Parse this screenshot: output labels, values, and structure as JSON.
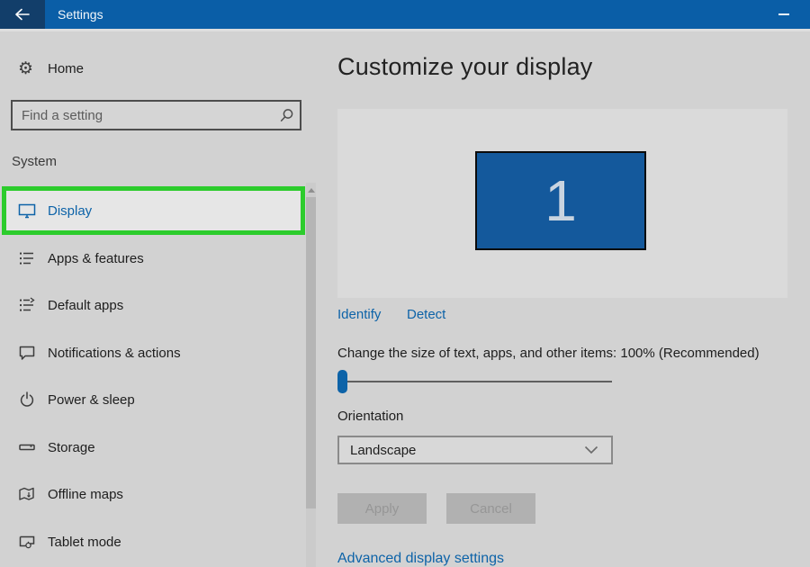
{
  "titlebar": {
    "title": "Settings"
  },
  "icons": {
    "gear_glyph": "⚙"
  },
  "sidebar": {
    "home_label": "Home",
    "search_placeholder": "Find a setting",
    "section_header": "System",
    "items": [
      {
        "label": "Display",
        "icon": "monitor-icon",
        "selected": true
      },
      {
        "label": "Apps & features",
        "icon": "apps-list-icon",
        "selected": false
      },
      {
        "label": "Default apps",
        "icon": "default-apps-icon",
        "selected": false
      },
      {
        "label": "Notifications & actions",
        "icon": "notifications-icon",
        "selected": false
      },
      {
        "label": "Power & sleep",
        "icon": "power-icon",
        "selected": false
      },
      {
        "label": "Storage",
        "icon": "storage-icon",
        "selected": false
      },
      {
        "label": "Offline maps",
        "icon": "offline-maps-icon",
        "selected": false
      },
      {
        "label": "Tablet mode",
        "icon": "tablet-icon",
        "selected": false
      }
    ]
  },
  "main": {
    "heading": "Customize your display",
    "monitor_number": "1",
    "identify_link": "Identify",
    "detect_link": "Detect",
    "scale_label": "Change the size of text, apps, and other items: 100% (Recommended)",
    "orientation_label": "Orientation",
    "orientation_value": "Landscape",
    "apply_button": "Apply",
    "cancel_button": "Cancel",
    "advanced_link": "Advanced display settings"
  },
  "colors": {
    "accent": "#0d63a8",
    "titlebar_blue": "#0a5ea7",
    "annotation_green": "#2ccc2c",
    "monitor_fill": "#14599c",
    "link_blue": "#0d63a8"
  }
}
